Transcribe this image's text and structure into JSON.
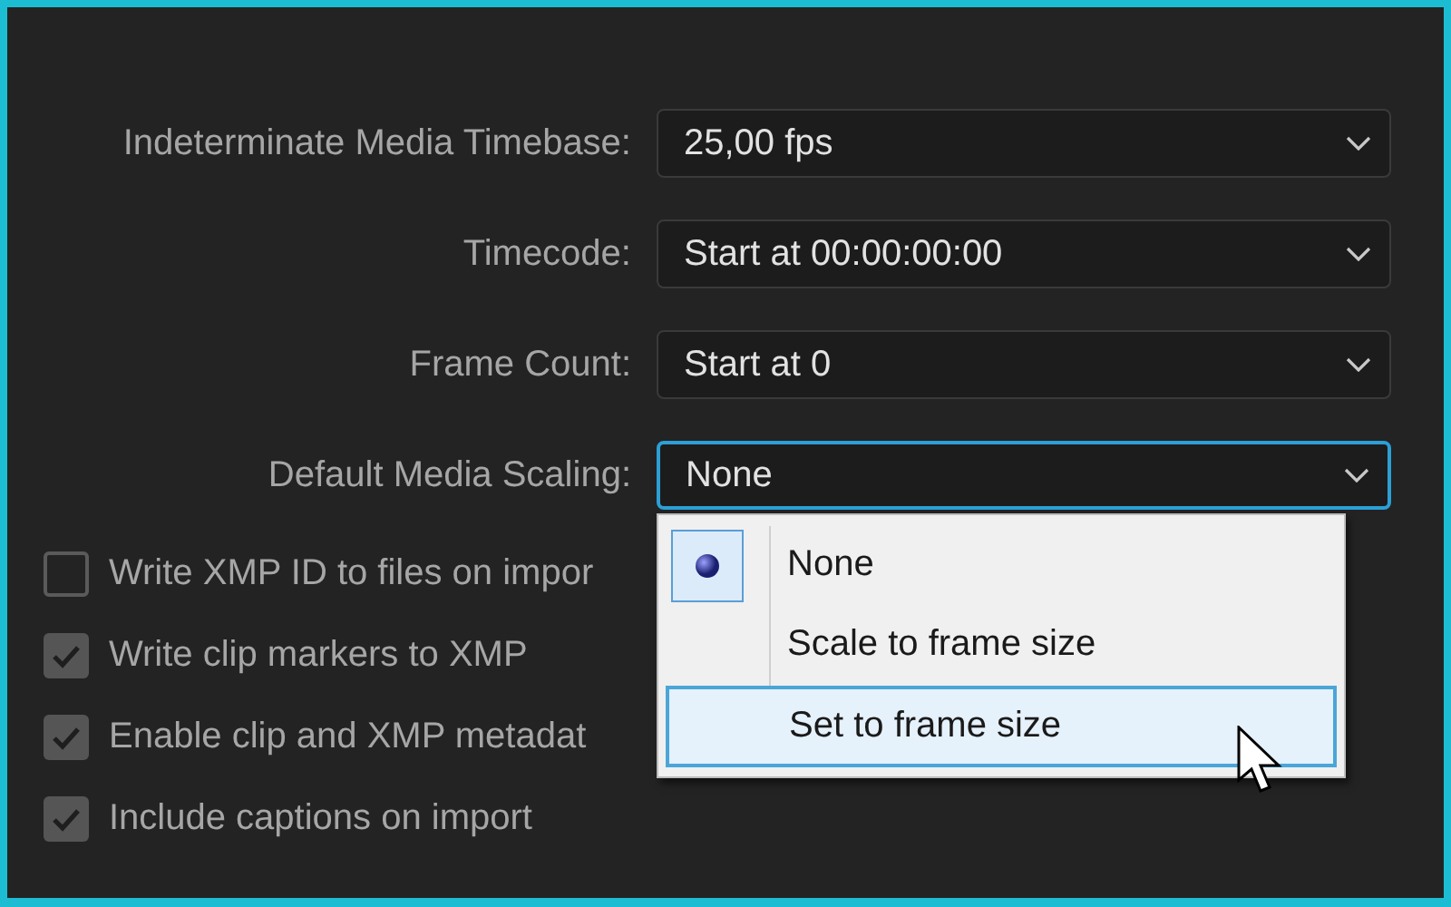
{
  "settings": [
    {
      "label": "Indeterminate Media Timebase:",
      "value": "25,00 fps",
      "focused": false
    },
    {
      "label": "Timecode:",
      "value": "Start at 00:00:00:00",
      "focused": false
    },
    {
      "label": "Frame Count:",
      "value": "Start at 0",
      "focused": false
    },
    {
      "label": "Default Media Scaling:",
      "value": "None",
      "focused": true
    }
  ],
  "checkboxes": [
    {
      "label": "Write XMP ID to files on impor",
      "checked": false
    },
    {
      "label": "Write clip markers to XMP",
      "checked": true
    },
    {
      "label": "Enable clip and XMP metadat",
      "checked": true
    },
    {
      "label": "Include captions on import",
      "checked": true
    }
  ],
  "dropdown_menu": {
    "items": [
      {
        "label": "None",
        "selected": true,
        "highlighted": false
      },
      {
        "label": "Scale to frame size",
        "selected": false,
        "highlighted": false
      },
      {
        "label": "Set to frame size",
        "selected": false,
        "highlighted": true
      }
    ]
  }
}
